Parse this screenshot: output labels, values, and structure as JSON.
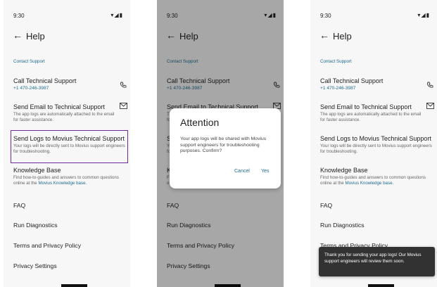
{
  "status": {
    "time": "9:30"
  },
  "header": {
    "back_icon": "←",
    "title": "Help"
  },
  "section": {
    "label": "Contact Support"
  },
  "items": {
    "call": {
      "label": "Call Technical Support",
      "phone": "+1 470-246-3987"
    },
    "email": {
      "label": "Send Email to Technical Support",
      "sub": "The app logs are automatically attached to the email for faster assistance."
    },
    "logs": {
      "label": "Send Logs to Movius Technical Support",
      "sub": "Your logs will be directly sent to Movius support engineers for troubleshooting."
    },
    "kb": {
      "label": "Knowledge Base",
      "sub_text": "Find how-to-guides and answers to common questions online at the ",
      "sub_link": "Movius Knowledge base."
    },
    "faq": "FAQ",
    "diag": "Run Diagnostics",
    "terms": "Terms and Privacy Policy",
    "privacy": "Privacy Settings"
  },
  "dialog": {
    "title": "Attention",
    "message": "Your app logs will be shared with Movius support engineers for troubleshooting purposes. Confirm?",
    "cancel": "Cancel",
    "yes": "Yes"
  },
  "toast": {
    "text": "Thank you for sending your app logs! Our Movius support engineers will review them soon."
  },
  "colors": {
    "accent": "#1f6b8f",
    "highlight": "#6b2aa0",
    "toast": "#323232"
  },
  "icons": {
    "phone": "phone-icon",
    "mail": "mail-icon",
    "back": "arrow-left-icon"
  }
}
